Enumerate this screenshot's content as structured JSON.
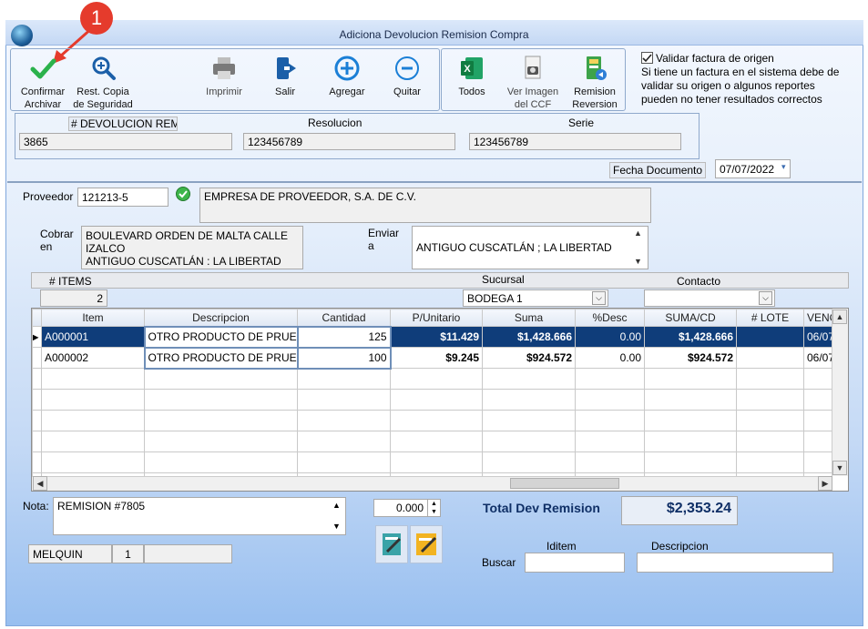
{
  "window": {
    "title": "Adiciona Devolucion Remision Compra"
  },
  "annotation": {
    "marker": "1"
  },
  "toolbar": {
    "confirm_line1": "Confirmar",
    "confirm_line2": "Archivar",
    "restore_line1": "Rest. Copia",
    "restore_line2": "de Seguridad",
    "print": "Imprimir",
    "exit": "Salir",
    "add": "Agregar",
    "remove": "Quitar",
    "all": "Todos",
    "view_line1": "Ver Imagen",
    "view_line2": "del CCF",
    "rev_line1": "Remision",
    "rev_line2": "Reversion"
  },
  "validate": {
    "label": "Validar factura de origen",
    "checked": true,
    "note": "Si tiene un factura en el sistema debe de validar su origen o algunos reportes pueden no tener resultados correctos"
  },
  "header": {
    "devolucion_label": "# DEVOLUCION REM",
    "devolucion_value": "3865",
    "resolucion_label": "Resolucion",
    "resolucion_value": "123456789",
    "serie_label": "Serie",
    "serie_value": "123456789",
    "fecha_label": "Fecha Documento",
    "fecha_value": "07/07/2022"
  },
  "provider": {
    "label": "Proveedor",
    "code": "121213-5",
    "name": "EMPRESA DE PROVEEDOR, S.A. DE C.V.",
    "cobrar_label1": "Cobrar",
    "cobrar_label2": "en",
    "cobrar_line1": "BOULEVARD ORDEN DE MALTA CALLE",
    "cobrar_line2": "IZALCO",
    "cobrar_line3": "ANTIGUO CUSCATLÁN : LA LIBERTAD",
    "enviar_label1": "Enviar",
    "enviar_label2": "a",
    "enviar_value": "ANTIGUO CUSCATLÁN ; LA LIBERTAD"
  },
  "summary": {
    "items_label": "# ITEMS",
    "items_value": "2",
    "sucursal_label": "Sucursal",
    "sucursal_value": "BODEGA 1",
    "contacto_label": "Contacto",
    "contacto_value": ""
  },
  "grid": {
    "columns": [
      "Item",
      "Descripcion",
      "Cantidad",
      "P/Unitario",
      "Suma",
      "%Desc",
      "SUMA/CD",
      "# LOTE",
      "VENC"
    ],
    "rows": [
      {
        "item": "A000001",
        "desc": "OTRO PRODUCTO DE PRUE",
        "qty": "125",
        "price": "$11.429",
        "sum": "$1,428.666",
        "disc": "0.00",
        "sumcd": "$1,428.666",
        "lote": "",
        "venc": "06/07"
      },
      {
        "item": "A000002",
        "desc": "OTRO PRODUCTO DE PRUE",
        "qty": "100",
        "price": "$9.245",
        "sum": "$924.572",
        "disc": "0.00",
        "sumcd": "$924.572",
        "lote": "",
        "venc": "06/07"
      }
    ]
  },
  "footer": {
    "nota_label": "Nota:",
    "nota_value": "REMISION  #7805",
    "spinner_value": "0.000",
    "total_label": "Total  Dev Remision",
    "total_value": "$2,353.24",
    "user": "MELQUIN",
    "user_num": "1",
    "iditem_label": "Iditem",
    "descripcion_label": "Descripcion",
    "buscar_label": "Buscar"
  },
  "colors": {
    "accent": "#0f3d7a",
    "confirm": "#2bb24c",
    "badge": "#e53b2c"
  }
}
